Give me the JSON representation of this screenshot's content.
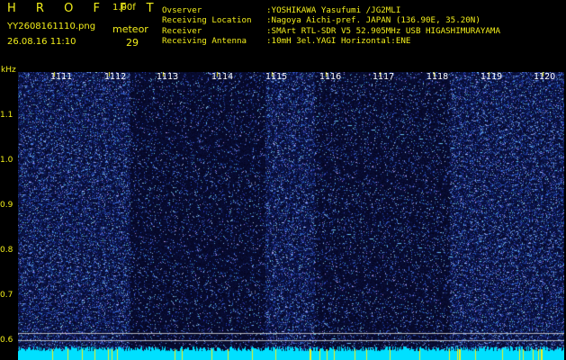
{
  "header": {
    "logo": "H R O F F T",
    "version": "1.00f",
    "filename": "YY2608161110.png",
    "datetime": "26.08.16 11:10",
    "meteor_label": "meteor",
    "meteor_count": "29"
  },
  "meta": [
    {
      "key": "Ovserver",
      "value": ":YOSHIKAWA Yasufumi /JG2MLI"
    },
    {
      "key": "Receiving Location",
      "value": ":Nagoya Aichi-pref. JAPAN (136.90E, 35.20N)"
    },
    {
      "key": "Receiver",
      "value": ":SMArt RTL-SDR V5 52.905MHz USB HIGASHIMURAYAMA"
    },
    {
      "key": "Receiving Antenna",
      "value": ":10mH 3el.YAGI Horizontal:ENE"
    }
  ],
  "axis": {
    "y_unit": "kHz",
    "y_ticks": [
      "1.1",
      "1.0",
      "0.9",
      "0.8",
      "0.7",
      "0.6"
    ],
    "x_ticks": [
      "1111",
      "1112",
      "1113",
      "1114",
      "1115",
      "1116",
      "1117",
      "1118",
      "1119",
      "1120"
    ]
  },
  "colors": {
    "text": "#f2ee1a",
    "noise_high": "#1a35c8",
    "noise_low": "#07104a",
    "baseline": "#00e0ff",
    "tick_marks": "#f2ee1a"
  }
}
